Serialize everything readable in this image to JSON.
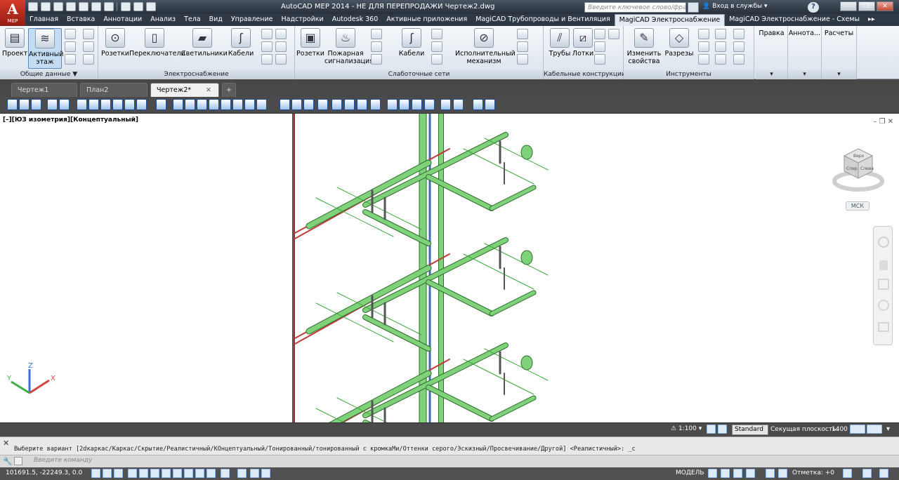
{
  "app": {
    "logo_letter": "A",
    "logo_sub": "MEP",
    "title": "AutoCAD MEP 2014 - НЕ ДЛЯ ПЕРЕПРОДАЖИ    Чертеж2.dwg",
    "search_placeholder": "Введите ключевое слово/фразу",
    "login_label": "Вход в службы",
    "help_label": "?",
    "win_min": "–",
    "win_restore": "❐",
    "win_close": "✕"
  },
  "menu_tabs": [
    {
      "label": "Главная"
    },
    {
      "label": "Вставка"
    },
    {
      "label": "Аннотации"
    },
    {
      "label": "Анализ"
    },
    {
      "label": "Тела"
    },
    {
      "label": "Вид"
    },
    {
      "label": "Управление"
    },
    {
      "label": "Надстройки"
    },
    {
      "label": "Autodesk 360"
    },
    {
      "label": "Активные приложения"
    },
    {
      "label": "MagiCAD Трубопроводы и Вентиляция"
    },
    {
      "label": "MagiCAD Электроснабжение"
    },
    {
      "label": "MagiCAD Электроснабжение - Схемы"
    },
    {
      "label": "▸▸"
    }
  ],
  "ribbon": {
    "general": {
      "title": "Общие данные ▼",
      "project": "Проект",
      "active_floor_1": "Активный",
      "active_floor_2": "этаж"
    },
    "power": {
      "title": "Электроснабжение",
      "sockets": "Розетки",
      "switches": "Переключатели",
      "lights": "Светильники",
      "cables": "Кабели"
    },
    "lowcurrent": {
      "title": "Слаботочные сети",
      "sockets": "Розетки",
      "fire_1": "Пожарная",
      "fire_2": "сигнализация",
      "cables": "Кабели",
      "actuator_1": "Исполнительный",
      "actuator_2": "механизм"
    },
    "cable_structures": {
      "title": "Кабельные конструкции",
      "pipes": "Трубы",
      "trays": "Лотки"
    },
    "tools": {
      "title": "Инструменты",
      "change_1": "Изменить",
      "change_2": "свойства",
      "sections": "Разрезы"
    },
    "right_panels": [
      "Правка",
      "Аннота...",
      "Расчеты"
    ]
  },
  "doc_tabs": [
    {
      "label": "Чертеж1"
    },
    {
      "label": "План2"
    },
    {
      "label": "Чертеж2*"
    }
  ],
  "doc_tab_close": "✕",
  "viewport": {
    "label": "[–][ЮЗ изометрия][Концептуальный]",
    "controls": "– ❐ ✕",
    "ucs_label": "МСК",
    "cube_top": "Верх",
    "cube_left": "Спер",
    "cube_right": "Слева"
  },
  "axes": {
    "x": "X",
    "y": "Y",
    "z": "Z"
  },
  "status1": {
    "scale": "1:100 ▾",
    "style": "Standard ▾",
    "section_label": "Секущая плоскость:",
    "section_value": "1400"
  },
  "command": {
    "history": "Выберите вариант [2dкаркас/Каркас/Скрытие/Реалистичный/КОнцептуальный/Тонированный/тонированный с кромкаМи/Оттенки серого/Эскизный/Просвечивание/Другой] <Реалистичный>: _c",
    "placeholder": "Введите команду"
  },
  "status2": {
    "coords": "101691.5, -22249.3, 0.0",
    "model": "МОДЕЛЬ",
    "elevation": "Отметка:  +0"
  },
  "colors": {
    "pipe_green": "#7fd27a",
    "pipe_red": "#c23a3a",
    "grid_green": "#3aa83a",
    "accent_blue": "#1d5fb0"
  }
}
